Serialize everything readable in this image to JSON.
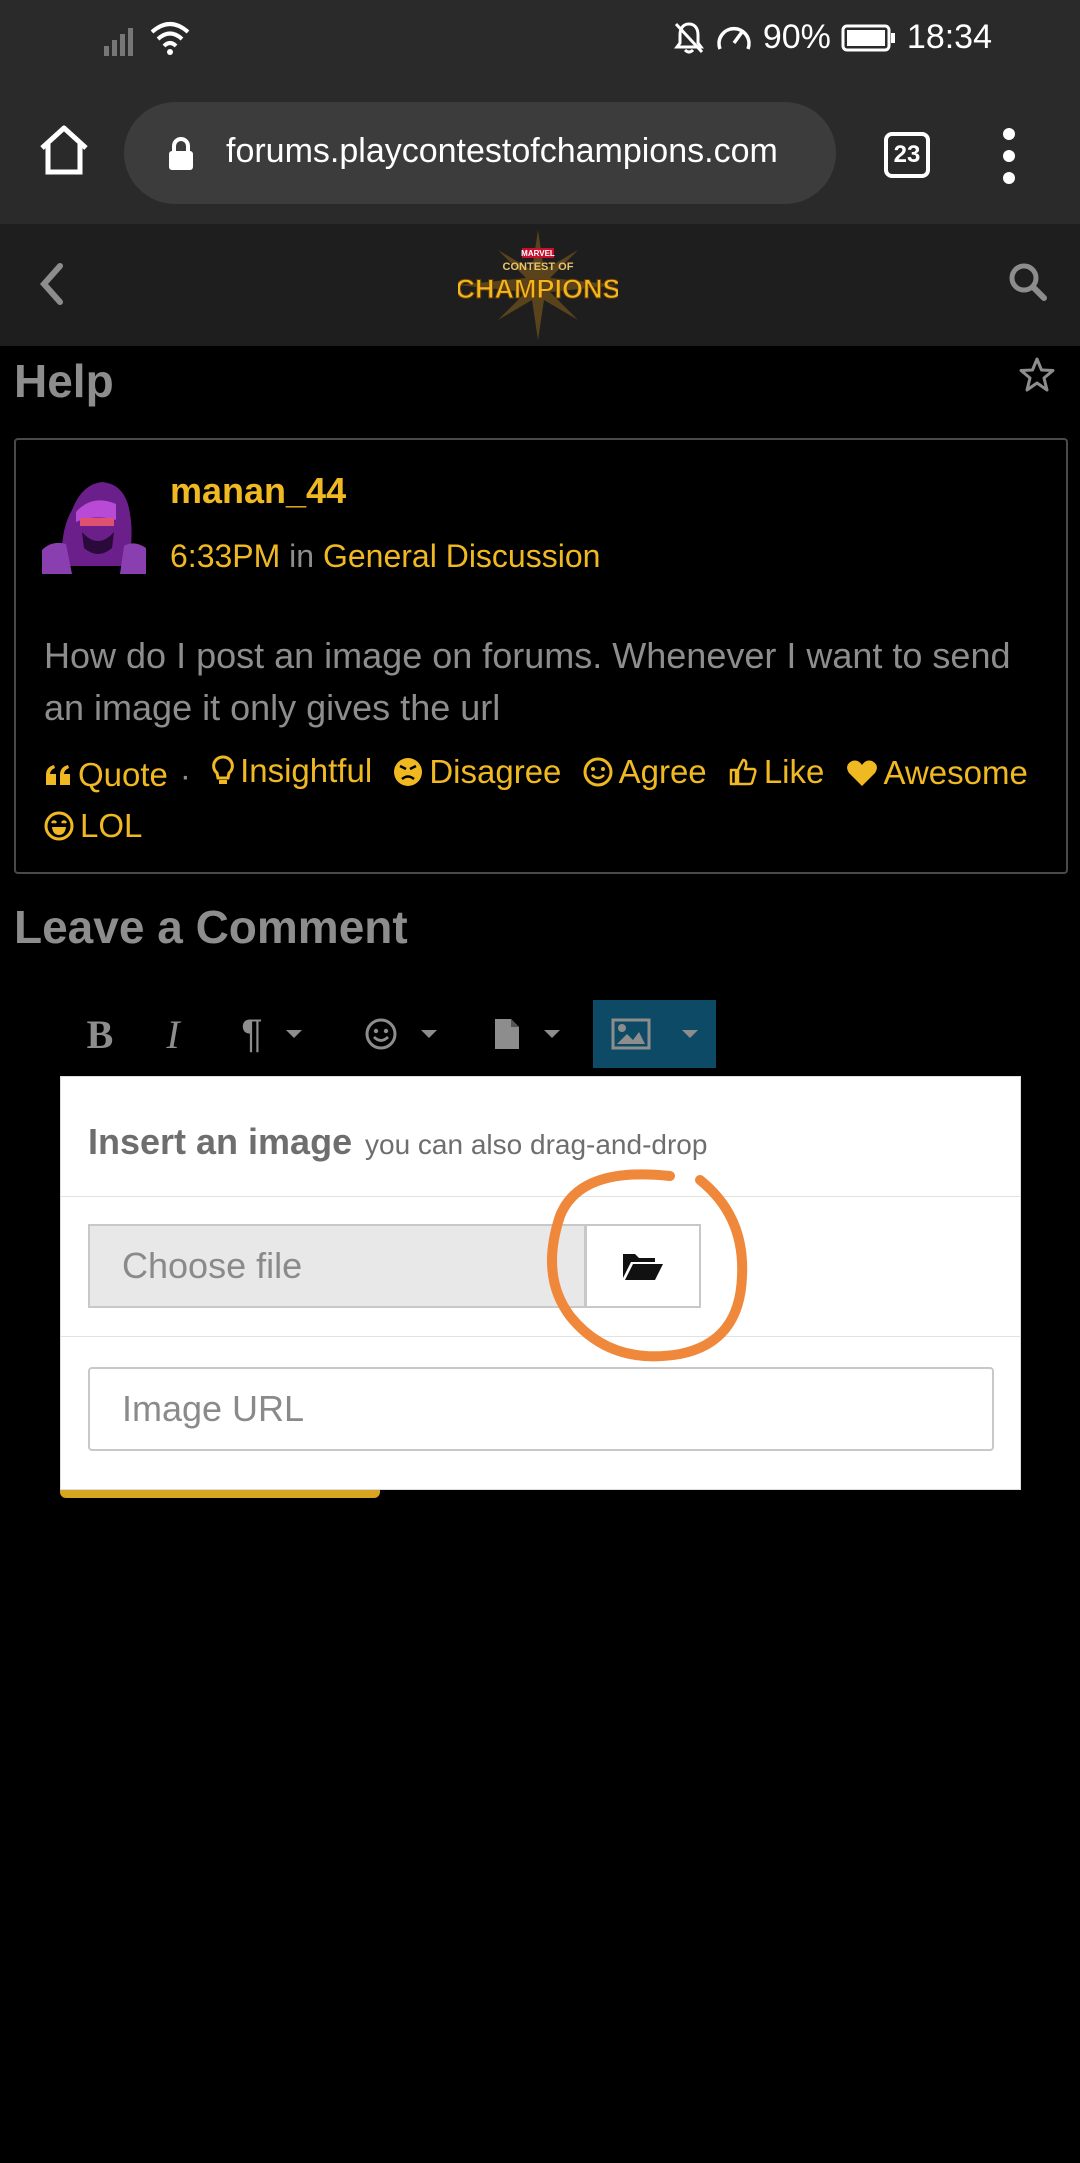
{
  "status_bar": {
    "battery": "90%",
    "time": "18:34"
  },
  "browser": {
    "url": "forums.playcontestofchampions.com",
    "tab_count": "23"
  },
  "site_header": {
    "logo_small": "MARVEL",
    "logo_top": "CONTEST OF",
    "logo_main": "CHAMPIONS"
  },
  "discussion": {
    "title": "Help"
  },
  "post": {
    "author": "manan_44",
    "time": "6:33PM",
    "in_label": "in",
    "category": "General Discussion",
    "body": "How do I post an image on forums. Whenever I want to send an image it only gives the url",
    "reactions": {
      "quote": "Quote",
      "insightful": "Insightful",
      "disagree": "Disagree",
      "agree": "Agree",
      "like": "Like",
      "awesome": "Awesome",
      "lol": "LOL"
    }
  },
  "comment": {
    "title": "Leave a Comment"
  },
  "toolbar": {
    "bold": "B",
    "italic": "I",
    "paragraph": "¶"
  },
  "image_popup": {
    "title": "Insert an image",
    "subtitle": "you can also drag-and-drop",
    "choose_file_label": "Choose file",
    "url_placeholder": "Image URL"
  },
  "colors": {
    "accent": "#f0b921",
    "muted_text": "#8d8d8d",
    "toolbar_active": "#0d4a66",
    "annotation": "#f0883c"
  }
}
